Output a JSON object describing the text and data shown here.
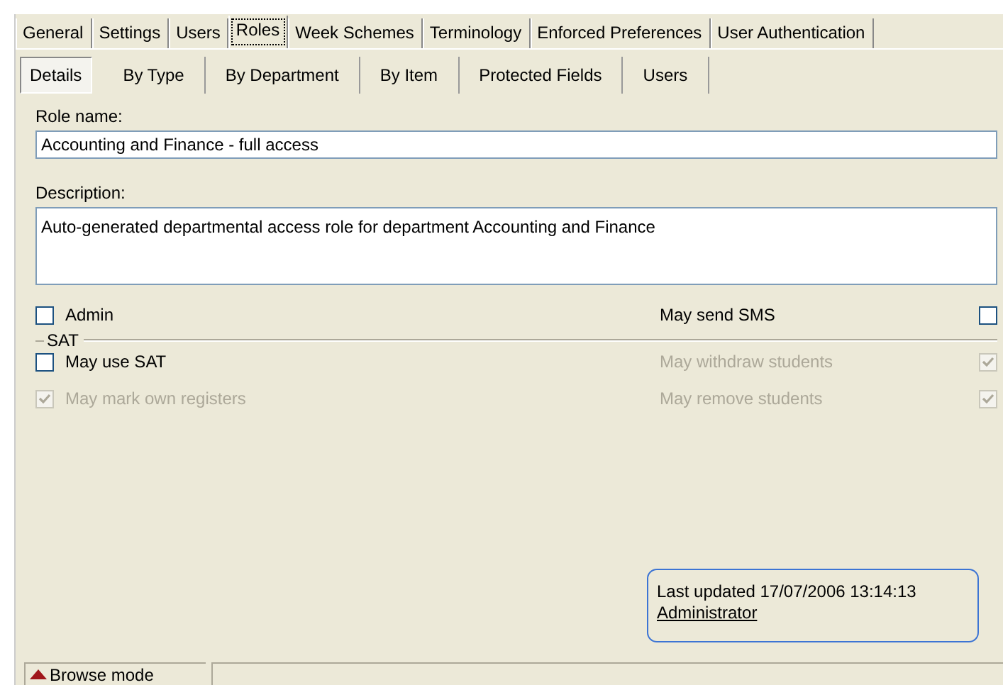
{
  "tabs": [
    {
      "label": "General",
      "selected": false
    },
    {
      "label": "Settings",
      "selected": false
    },
    {
      "label": "Users",
      "selected": false
    },
    {
      "label": "Roles",
      "selected": true
    },
    {
      "label": "Week Schemes",
      "selected": false
    },
    {
      "label": "Terminology",
      "selected": false
    },
    {
      "label": "Enforced Preferences",
      "selected": false
    },
    {
      "label": "User Authentication",
      "selected": false
    }
  ],
  "subtabs": [
    {
      "label": "Details",
      "selected": true
    },
    {
      "label": "By Type",
      "selected": false
    },
    {
      "label": "By Department",
      "selected": false
    },
    {
      "label": "By Item",
      "selected": false
    },
    {
      "label": "Protected Fields",
      "selected": false
    },
    {
      "label": "Users",
      "selected": false
    }
  ],
  "role_name": {
    "label": "Role name:",
    "value": "Accounting and Finance - full access"
  },
  "description": {
    "label": "Description:",
    "value": "Auto-generated departmental access role for department Accounting and Finance"
  },
  "general_options": {
    "left": [
      {
        "label": "Admin",
        "checked": false,
        "disabled": false
      }
    ],
    "right": [
      {
        "label": "May send SMS",
        "checked": false,
        "disabled": false
      }
    ]
  },
  "sat": {
    "title": "SAT",
    "left": [
      {
        "label": "May use SAT",
        "checked": false,
        "disabled": false
      },
      {
        "label": "May mark own registers",
        "checked": true,
        "disabled": true
      }
    ],
    "right": [
      {
        "label": "May withdraw students",
        "checked": true,
        "disabled": true
      },
      {
        "label": "May remove students",
        "checked": true,
        "disabled": true
      }
    ]
  },
  "last_updated": {
    "text": "Last updated 17/07/2006 13:14:13",
    "user": "Administrator"
  },
  "status_bar": {
    "mode": "Browse mode"
  }
}
